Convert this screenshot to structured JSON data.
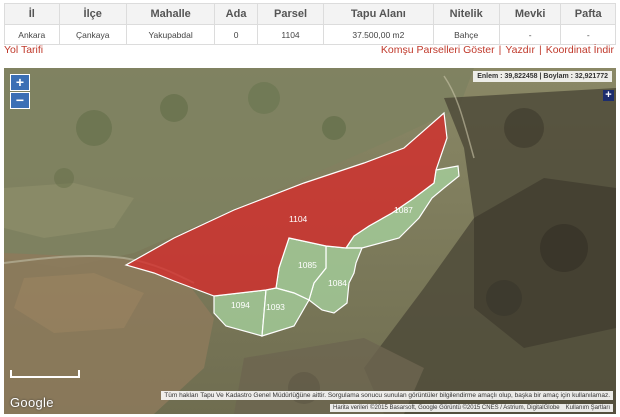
{
  "table": {
    "headers": [
      "İl",
      "İlçe",
      "Mahalle",
      "Ada",
      "Parsel",
      "Tapu Alanı",
      "Nitelik",
      "Mevki",
      "Pafta"
    ],
    "row": [
      "Ankara",
      "Çankaya",
      "Yakupabdal",
      "0",
      "1104",
      "37.500,00 m2",
      "Bahçe",
      "-",
      "-"
    ]
  },
  "links": {
    "route": "Yol Tarifi",
    "neighbors": "Komşu Parselleri Göster",
    "print": "Yazdır",
    "download": "Koordinat İndir",
    "separator": "|"
  },
  "map": {
    "zoom_in": "+",
    "zoom_out": "−",
    "coords": "Enlem : 39,822458 | Boylam : 32,921772",
    "layer_button": "+",
    "disclaimer": "Tüm hakları Tapu Ve Kadastro Genel Müdürlüğüne aittir. Sorgulama sonucu sunulan görüntüler bilgilendirme amaçlı olup, başka bir amaç için kullanılamaz.",
    "attribution": "Harita verileri ©2015 Basarsoft, Google Görüntü ©2015 CNES / Astrium, DigitalGlobe",
    "terms": "Kullanım Şartları",
    "logo": "Google",
    "parcels": [
      "1104",
      "1087",
      "1085",
      "1084",
      "1094",
      "1093"
    ],
    "colors": {
      "selected": "#d62a2a",
      "neighbor": "#a8d5a0"
    }
  }
}
